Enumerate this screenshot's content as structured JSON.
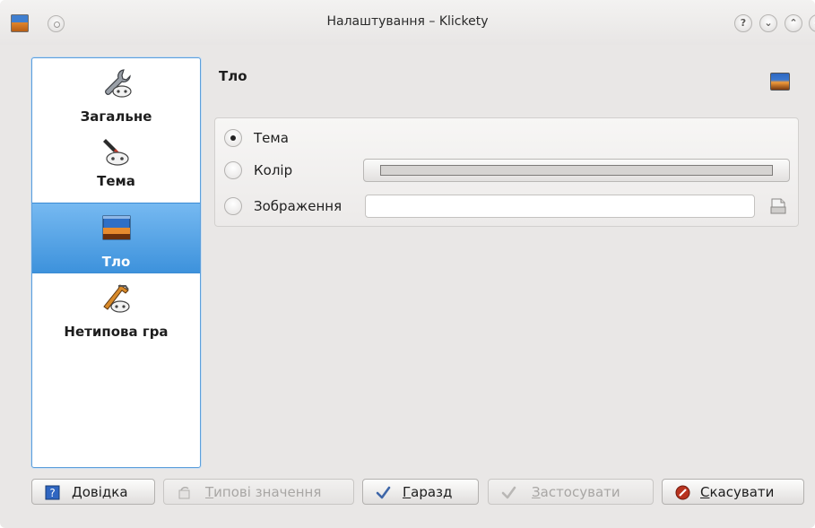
{
  "window": {
    "title": "Налаштування – Klickety",
    "controls": {
      "help": "?",
      "minimize": "⌄",
      "maximize": "⌃",
      "close": "×"
    }
  },
  "sidebar": {
    "items": [
      {
        "label": "Загальне",
        "icon": "wrench-gamepad-icon",
        "active": false
      },
      {
        "label": "Тема",
        "icon": "paintbrush-gamepad-icon",
        "active": false
      },
      {
        "label": "Тло",
        "icon": "landscape-picture-icon",
        "active": true
      },
      {
        "label": "Нетипова гра",
        "icon": "hammer-gamepad-icon",
        "active": false
      }
    ]
  },
  "panel": {
    "title": "Тло",
    "header_icon": "landscape-picture-icon",
    "options": [
      {
        "label": "Тема",
        "checked": true
      },
      {
        "label": "Колір",
        "checked": false
      },
      {
        "label": "Зображення",
        "checked": false
      }
    ],
    "color_value": "#d6d4d2",
    "image_value": "",
    "browse_icon": "document-open-icon"
  },
  "buttons": {
    "help": {
      "accel": "Д",
      "rest": "овідка",
      "enabled": true,
      "icon": "help-book-icon"
    },
    "defaults": {
      "accel": "Т",
      "rest": "ипові значення",
      "enabled": false,
      "icon": "restore-defaults-icon"
    },
    "ok": {
      "accel": "Г",
      "rest": "аразд",
      "enabled": true,
      "icon": "checkmark-icon"
    },
    "apply": {
      "accel": "З",
      "rest": "астосувати",
      "enabled": false,
      "icon": "checkmark-icon"
    },
    "cancel": {
      "accel": "С",
      "rest": "касувати",
      "enabled": true,
      "icon": "cancel-icon"
    }
  },
  "colors": {
    "accent": "#3d92dc",
    "selection_top": "#76b9f1"
  }
}
